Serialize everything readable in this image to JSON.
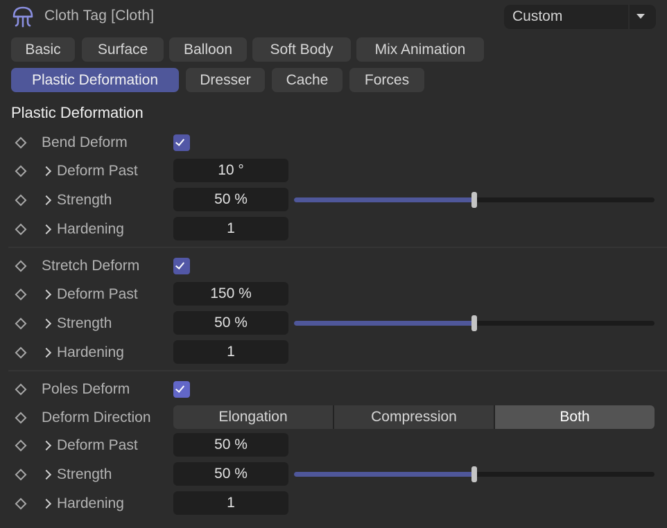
{
  "header": {
    "title": "Cloth Tag [Cloth]",
    "preset": "Custom",
    "logo_icon": "jellyfish-cloth-icon",
    "logo_color": "#8a8fe0"
  },
  "tabs": [
    {
      "label": "Basic",
      "active": false
    },
    {
      "label": "Surface",
      "active": false
    },
    {
      "label": "Balloon",
      "active": false
    },
    {
      "label": "Soft Body",
      "active": false
    },
    {
      "label": "Mix Animation",
      "active": false
    },
    {
      "label": "Plastic Deformation",
      "active": true
    },
    {
      "label": "Dresser",
      "active": false
    },
    {
      "label": "Cache",
      "active": false
    },
    {
      "label": "Forces",
      "active": false
    }
  ],
  "section_title": "Plastic Deformation",
  "colors": {
    "accent": "#4f579a",
    "checkbox": "#5257a6",
    "field_bg": "#1f1f1f",
    "panel_bg": "#2c2c2c"
  },
  "bend": {
    "label": "Bend Deform",
    "enabled": true,
    "deform_past_label": "Deform Past",
    "deform_past": "10 °",
    "strength_label": "Strength",
    "strength": "50 %",
    "strength_fraction": 0.5,
    "hardening_label": "Hardening",
    "hardening": "1"
  },
  "stretch": {
    "label": "Stretch Deform",
    "enabled": true,
    "deform_past_label": "Deform Past",
    "deform_past": "150 %",
    "strength_label": "Strength",
    "strength": "50 %",
    "strength_fraction": 0.5,
    "hardening_label": "Hardening",
    "hardening": "1"
  },
  "poles": {
    "label": "Poles Deform",
    "enabled": true,
    "direction_label": "Deform Direction",
    "direction_options": [
      "Elongation",
      "Compression",
      "Both"
    ],
    "direction_selected": "Both",
    "deform_past_label": "Deform Past",
    "deform_past": "50 %",
    "strength_label": "Strength",
    "strength": "50 %",
    "strength_fraction": 0.5,
    "hardening_label": "Hardening",
    "hardening": "1"
  }
}
